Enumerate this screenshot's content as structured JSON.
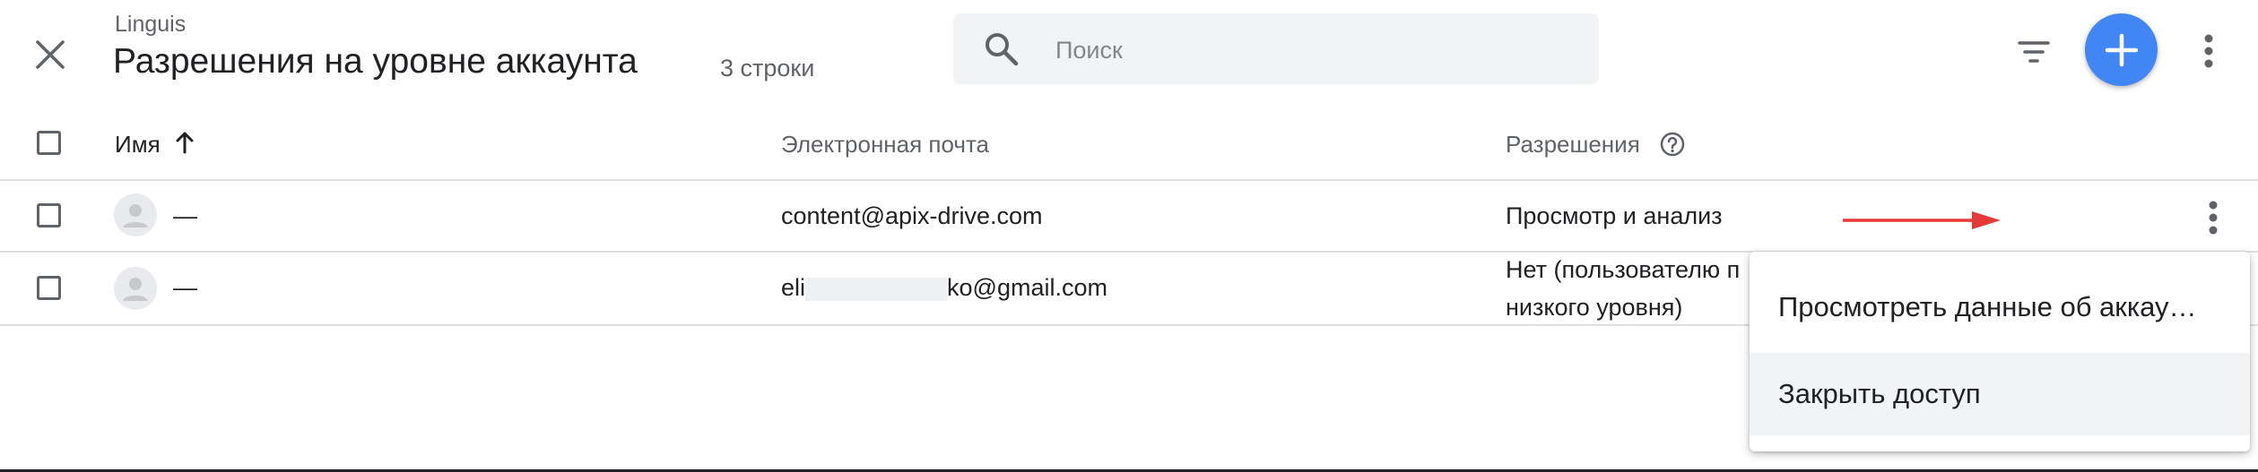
{
  "header": {
    "app_name": "Linguis",
    "title": "Разрешения на уровне аккаунта",
    "row_count": "3 строки"
  },
  "search": {
    "placeholder": "Поиск",
    "icon": "search-icon"
  },
  "toolbar": {
    "icons": [
      "close-icon",
      "filter-icon",
      "add-icon",
      "more-vert-icon"
    ],
    "accent_color": "#4285f4"
  },
  "table": {
    "columns": [
      {
        "label": "Имя",
        "sort": "arrow-up-icon"
      },
      {
        "label": "Электронная почта"
      },
      {
        "label": "Разрешения",
        "info": "help-circle-icon"
      }
    ],
    "rows": [
      {
        "name": "—",
        "email": "content@apix-drive.com",
        "permission": "Просмотр и анализ"
      },
      {
        "name": "—",
        "email_prefix": "eli",
        "email_suffix": "ko@gmail.com",
        "permission_line1": "Нет (пользователю п",
        "permission_line2": "низкого уровня)"
      }
    ]
  },
  "menu": {
    "items": [
      {
        "label": "Просмотреть данные об аккау…"
      },
      {
        "label": "Закрыть доступ"
      }
    ]
  },
  "annotation": {
    "arrow_color": "#e53935"
  }
}
